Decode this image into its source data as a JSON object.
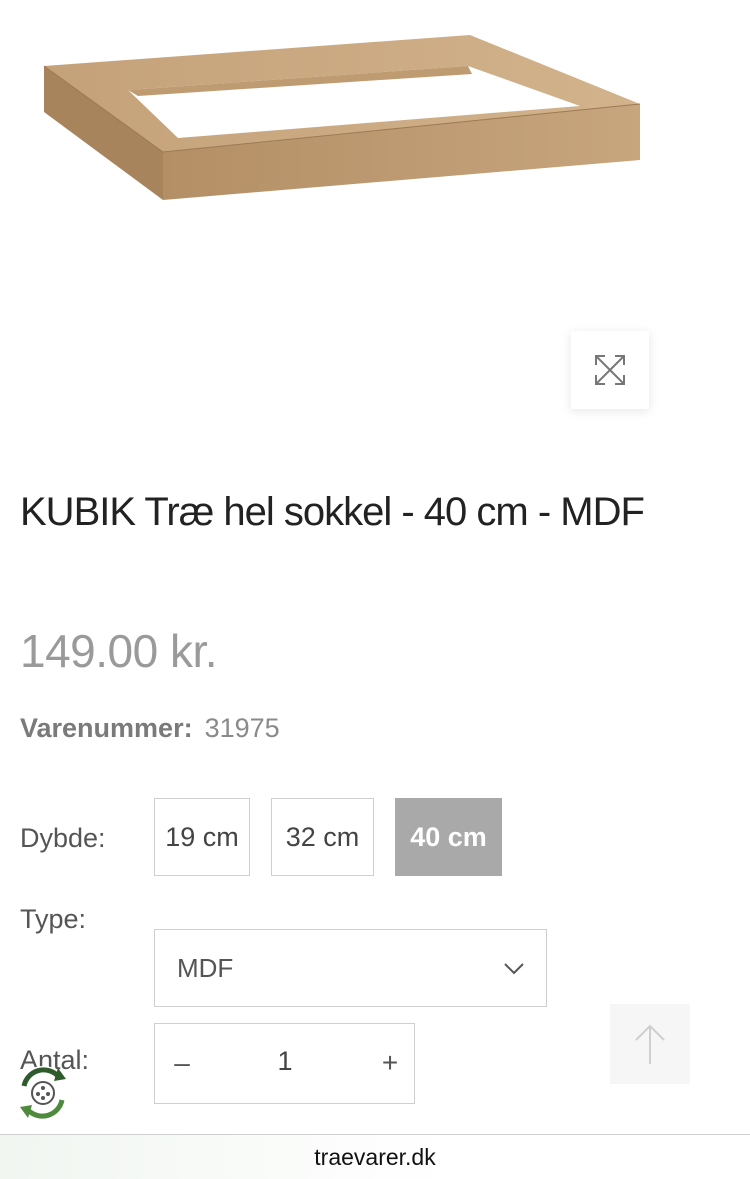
{
  "product": {
    "title": "KUBIK Træ hel sokkel - 40 cm - MDF",
    "price": "149.00 kr.",
    "sku_label": "Varenummer:",
    "sku_value": "31975"
  },
  "options": {
    "depth_label": "Dybde:",
    "depths": [
      {
        "label": "19 cm",
        "selected": false
      },
      {
        "label": "32 cm",
        "selected": false
      },
      {
        "label": "40 cm",
        "selected": true
      }
    ],
    "type_label": "Type:",
    "type_selected": "MDF",
    "quantity_label": "Antal:",
    "quantity_value": "1",
    "decrement": "–",
    "increment": "+"
  },
  "browser": {
    "domain": "traevarer.dk"
  },
  "icons": {
    "zoom": "expand-icon",
    "select": "chevron-down-icon",
    "scroll_top": "arrow-up-icon",
    "badge": "recycle-badge-icon"
  },
  "colors": {
    "selected_option": "#a9a9a9",
    "price": "#9a9a9a",
    "wood": "#c9a77f"
  }
}
